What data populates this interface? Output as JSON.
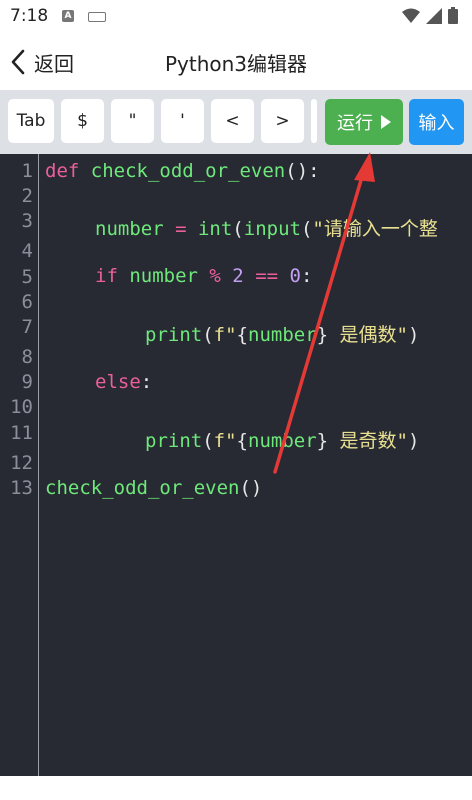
{
  "status_bar": {
    "time": "7:18",
    "notif_letter": "A"
  },
  "header": {
    "back_label": "返回",
    "title": "Python3编辑器"
  },
  "toolbar": {
    "symbols": [
      "Tab",
      "$",
      "\"",
      "'",
      "<",
      ">"
    ],
    "run_label": "运行",
    "input_label": "输入"
  },
  "editor": {
    "line_numbers": [
      "1",
      "2",
      "3",
      "4",
      "5",
      "6",
      "7",
      "8",
      "9",
      "10",
      "11",
      "12",
      "13"
    ],
    "code": {
      "l1_kw": "def",
      "l1_fn": "check_odd_or_even",
      "l1_punc": "():",
      "l3_var": "number",
      "l3_eq": " = ",
      "l3_fn": "int",
      "l3_p1": "(",
      "l3_fn2": "input",
      "l3_p2": "(",
      "l3_str": "\"请输入一个整",
      "l5_kw": "if",
      "l5_var": " number",
      "l5_op": " %",
      "l5_num": " 2",
      "l5_op2": " ==",
      "l5_num2": " 0",
      "l5_punc": ":",
      "l7_fn": "print",
      "l7_p": "(",
      "l7_str1": "f\"",
      "l7_brace1": "{",
      "l7_var": "number",
      "l7_brace2": "}",
      "l7_str2": " 是偶数\"",
      "l7_p2": ")",
      "l9_kw": "else",
      "l9_punc": ":",
      "l11_fn": "print",
      "l11_p": "(",
      "l11_str1": "f\"",
      "l11_brace1": "{",
      "l11_var": "number",
      "l11_brace2": "}",
      "l11_str2": " 是奇数\"",
      "l11_p2": ")",
      "l13_fn": "check_odd_or_even",
      "l13_punc": "()"
    }
  },
  "colors": {
    "run_button": "#4caf50",
    "input_button": "#2196f3",
    "editor_bg": "#272a33",
    "annotation_arrow": "#e53935"
  },
  "icons": {
    "back": "chevron-left-icon",
    "wifi": "wifi-icon",
    "signal": "signal-icon",
    "battery": "battery-icon",
    "run": "play-icon"
  }
}
